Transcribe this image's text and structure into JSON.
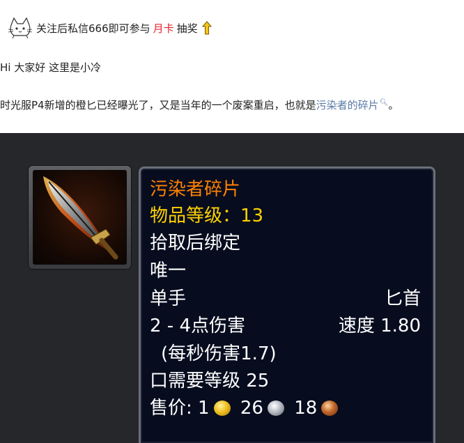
{
  "header": {
    "line1": {
      "prefix": "关注后私信666即可参与",
      "highlight": "月卡",
      "suffix": "抽奖"
    },
    "line2": "Hi 大家好 这里是小冷",
    "line3": {
      "prefix": "时光服P4新增的橙匕已经曝光了，又是当年的一个废案重启，也就是",
      "link": "污染者的碎片",
      "suffix": "。"
    }
  },
  "tooltip": {
    "item_name": "污染者碎片",
    "item_level_label": "物品等级：",
    "item_level_value": "13",
    "bind": "拾取后绑定",
    "unique": "唯一",
    "slot": "单手",
    "type": "匕首",
    "damage": "2 - 4点伤害",
    "speed": "速度 1.80",
    "dps": "(每秒伤害1.7)",
    "req_level": "口需要等级 25",
    "sell_label": "售价:",
    "gold": "1",
    "silver": "26",
    "copper": "18"
  },
  "colors": {
    "legendary": "#ff8000",
    "item_level": "#ffd100",
    "link": "#5a79a6",
    "highlight_red": "#e8232c",
    "tooltip_bg": "#070d1f"
  }
}
